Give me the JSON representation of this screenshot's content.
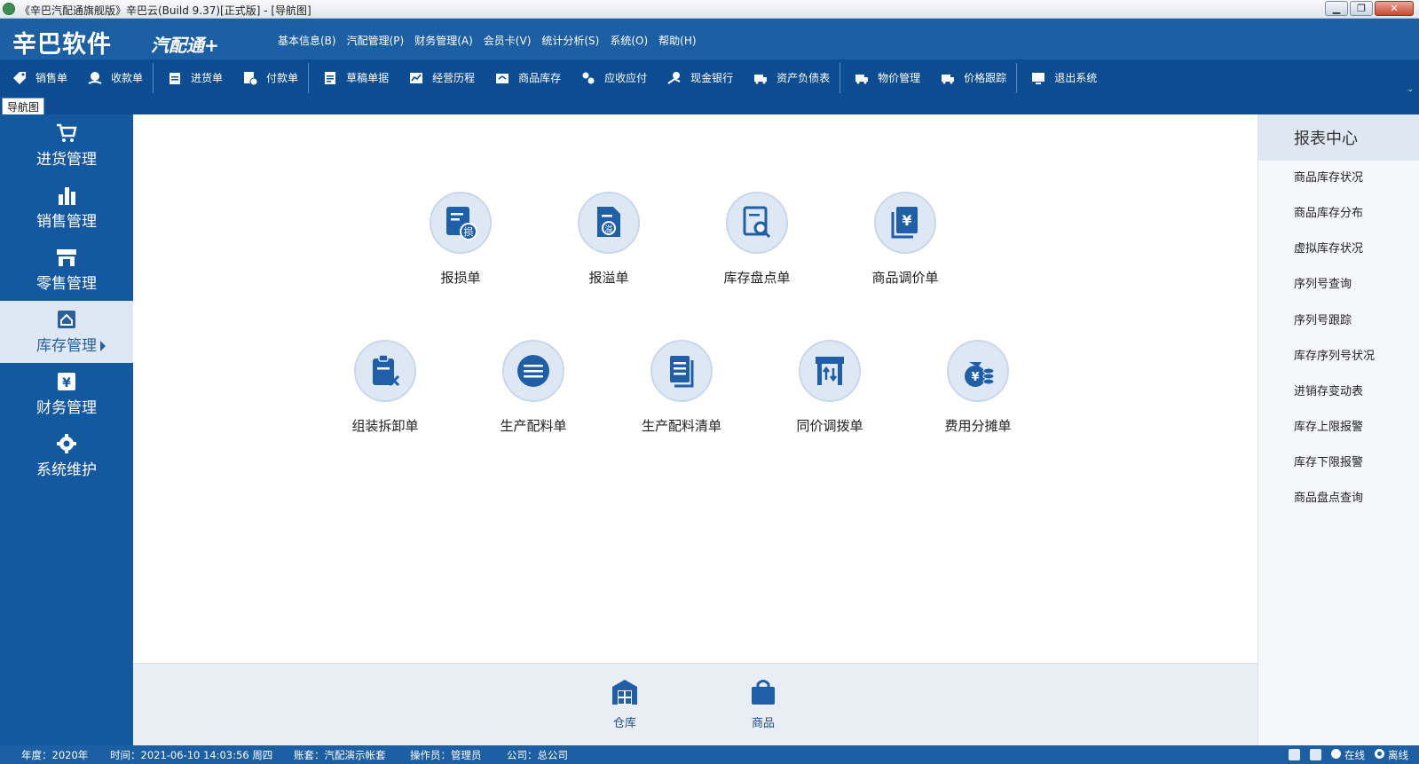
{
  "window": {
    "title": "《辛巴汽配通旗舰版》辛巴云(Build 9.37)[正式版] - [导航图]",
    "min_label": "▁",
    "restore_label": "❐",
    "close_label": "✕"
  },
  "header": {
    "logo_main": "辛巴软件",
    "logo_sub": "汽配通+",
    "menu": [
      "基本信息(B)",
      "汽配管理(P)",
      "财务管理(A)",
      "会员卡(V)",
      "统计分析(S)",
      "系统(O)",
      "帮助(H)"
    ]
  },
  "toolbar": {
    "items": [
      "销售单",
      "收款单",
      "进货单",
      "付款单",
      "草稿单据",
      "经营历程",
      "商品库存",
      "应收应付",
      "现金银行",
      "资产负债表",
      "物价管理",
      "价格跟踪",
      "退出系统"
    ],
    "caret": "⌄"
  },
  "tabs": {
    "active": "导航图"
  },
  "sidebar": {
    "items": [
      "进货管理",
      "销售管理",
      "零售管理",
      "库存管理",
      "财务管理",
      "系统维护"
    ],
    "active_index": 3
  },
  "main": {
    "row1": [
      "报损单",
      "报溢单",
      "库存盘点单",
      "商品调价单"
    ],
    "row2": [
      "组装拆卸单",
      "生产配料单",
      "生产配料清单",
      "同价调拨单",
      "费用分摊单"
    ]
  },
  "dock": {
    "items": [
      "仓库",
      "商品"
    ]
  },
  "report_center": {
    "title": "报表中心",
    "items": [
      "商品库存状况",
      "商品库存分布",
      "虚拟库存状况",
      "序列号查询",
      "序列号跟踪",
      "库存序列号状况",
      "进销存变动表",
      "库存上限报警",
      "库存下限报警",
      "商品盘点查询"
    ]
  },
  "status": {
    "year": "年度：2020年",
    "time": "时间：2021-06-10 14:03:56 周四",
    "account": "账套：汽配演示帐套",
    "operator": "操作员：管理员",
    "company": "公司：总公司",
    "online": "在线",
    "offline": "离线"
  },
  "colors": {
    "brand_blue": "#1d5fa3",
    "toolbar_blue": "#0c4d92",
    "icon_blue": "#1f5fa7",
    "circle_bg": "#dde8f4"
  }
}
